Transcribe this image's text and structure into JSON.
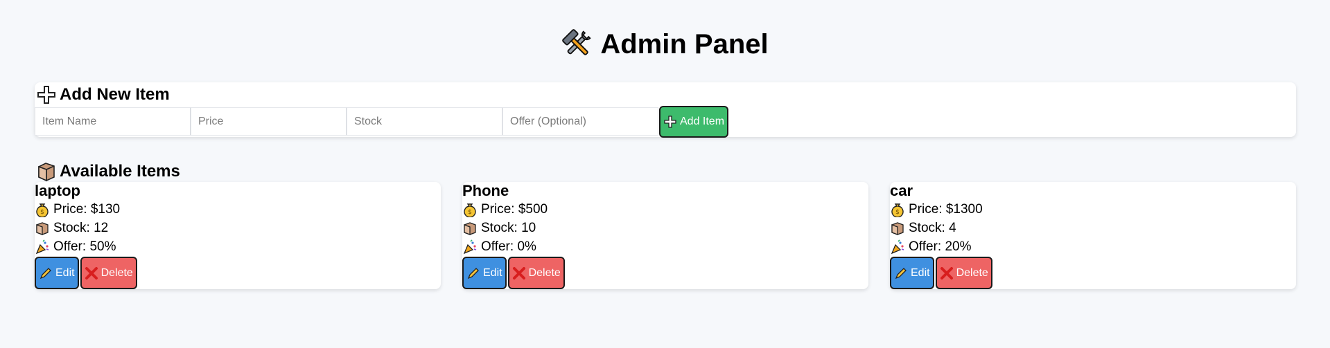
{
  "header": {
    "title": "Admin Panel",
    "icon": "hammer-wrench-icon"
  },
  "add_item": {
    "heading": "Add New Item",
    "heading_icon": "plus-icon",
    "fields": {
      "name_placeholder": "Item Name",
      "price_placeholder": "Price",
      "stock_placeholder": "Stock",
      "offer_placeholder": "Offer (Optional)"
    },
    "add_button_label": "Add Item",
    "add_button_color": "#3dbb6c"
  },
  "available": {
    "heading": "Available Items",
    "heading_icon": "box-icon",
    "items": [
      {
        "name": "laptop",
        "price": "Price: $130",
        "stock": "Stock: 12",
        "offer": "Offer: 50%"
      },
      {
        "name": "Phone",
        "price": "Price: $500",
        "stock": "Stock: 10",
        "offer": "Offer: 0%"
      },
      {
        "name": "car",
        "price": "Price: $1300",
        "stock": "Stock: 4",
        "offer": "Offer: 20%"
      }
    ],
    "edit_label": "Edit",
    "delete_label": "Delete",
    "edit_color": "#3f90e0",
    "delete_color": "#ee6464"
  }
}
